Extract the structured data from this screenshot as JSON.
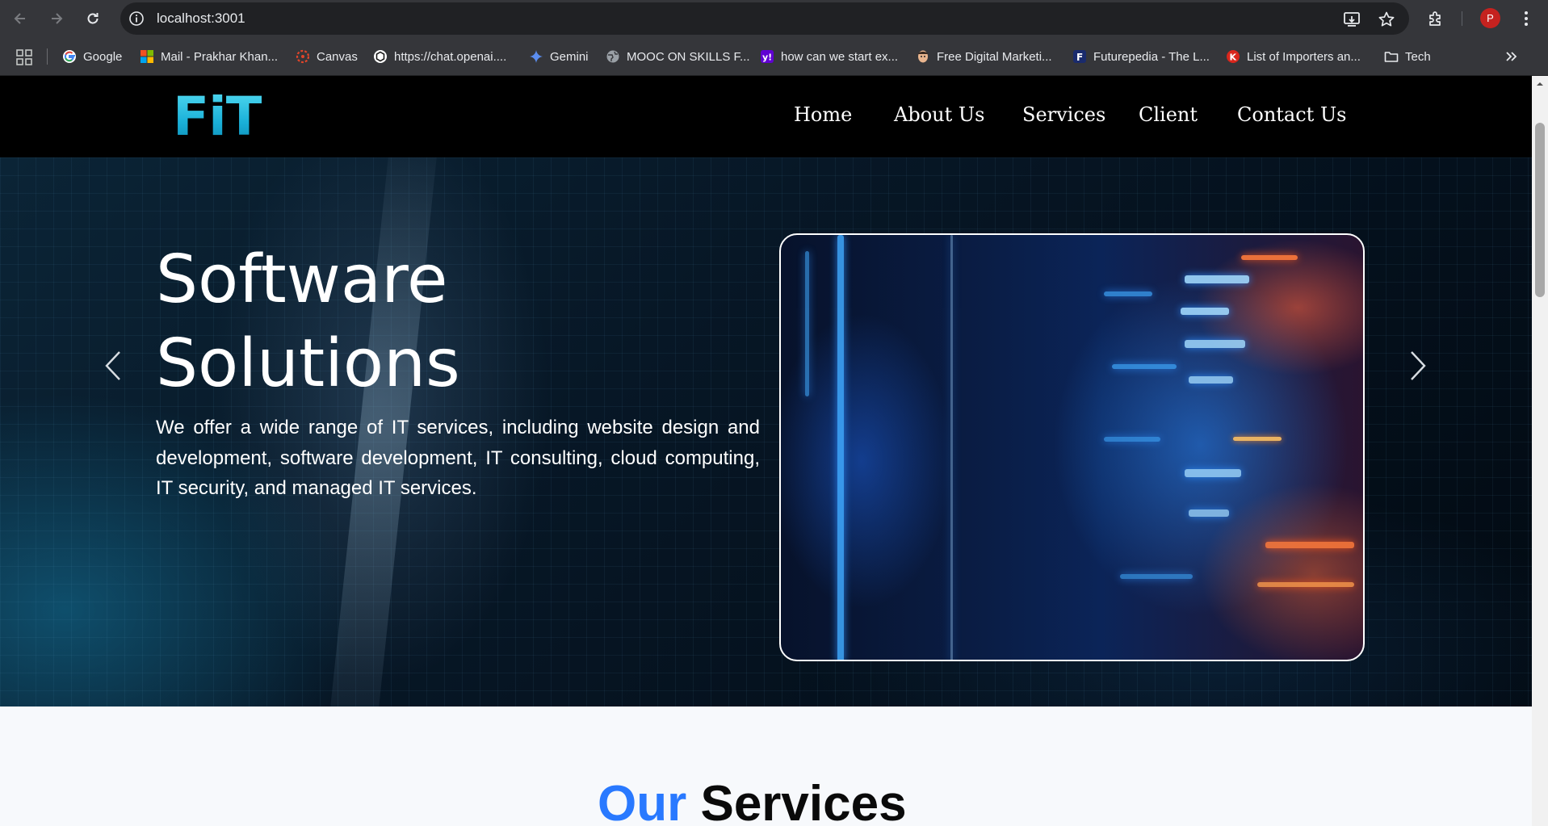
{
  "browser": {
    "url": "localhost:3001",
    "profile_initial": "P",
    "bookmarks": [
      {
        "label": "Google",
        "icon": "google-icon"
      },
      {
        "label": "Mail - Prakhar Khan...",
        "icon": "microsoft-icon"
      },
      {
        "label": "Canvas",
        "icon": "canvas-icon"
      },
      {
        "label": "https://chat.openai....",
        "icon": "openai-icon"
      },
      {
        "label": "Gemini",
        "icon": "gemini-icon"
      },
      {
        "label": "MOOC ON SKILLS F...",
        "icon": "globe-icon"
      },
      {
        "label": "how can we start ex...",
        "icon": "yahoo-icon"
      },
      {
        "label": "Free Digital Marketi...",
        "icon": "avatar-icon"
      },
      {
        "label": "Futurepedia - The L...",
        "icon": "futurepedia-icon"
      },
      {
        "label": "List of Importers an...",
        "icon": "k-icon"
      },
      {
        "label": "Tech",
        "icon": "folder-icon"
      }
    ]
  },
  "site": {
    "logo": "FiT",
    "nav": [
      "Home",
      "About Us",
      "Services",
      "Client",
      "Contact Us"
    ],
    "hero": {
      "title_line1": "Software",
      "title_line2": "Solutions",
      "description": "We offer a wide range of IT services, including website design and development, software development, IT consulting, cloud computing, IT security, and managed IT services."
    },
    "services_heading": {
      "accent": "Our",
      "rest": "Services"
    }
  },
  "colors": {
    "logo": "#1ab0d8",
    "accent": "#2979ff",
    "header_bg": "#000000",
    "section_bg": "#f7f9fc"
  }
}
